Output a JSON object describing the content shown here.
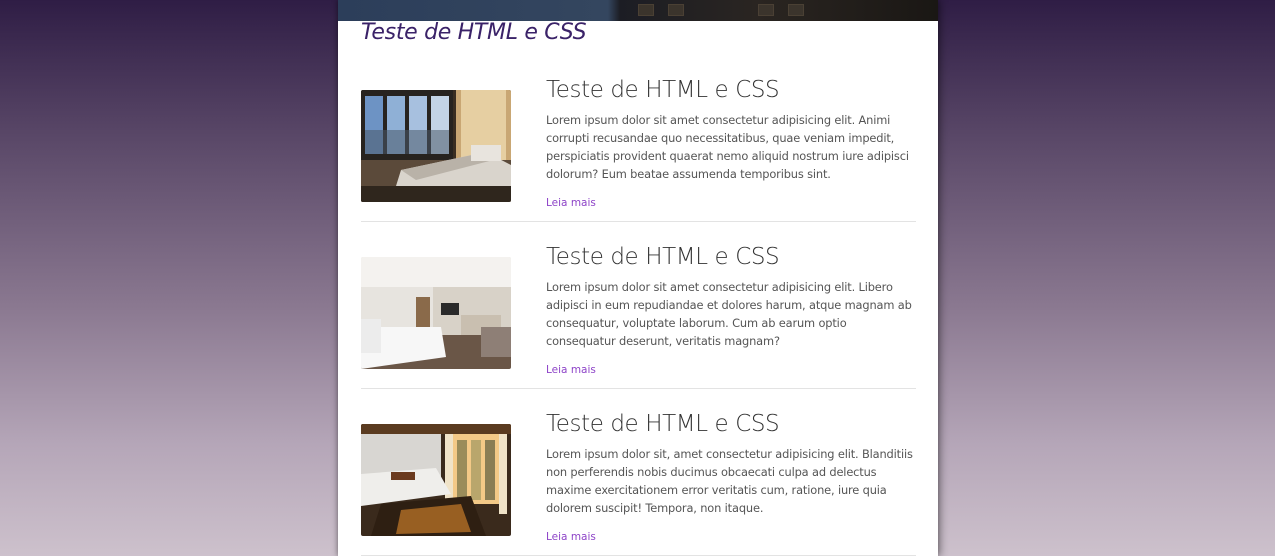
{
  "section": {
    "title": "Teste de HTML e CSS"
  },
  "posts": [
    {
      "title": "Teste de HTML e CSS",
      "text": "Lorem ipsum dolor sit amet consectetur adipisicing elit. Animi corrupti recusandae quo necessitatibus, quae veniam impedit, perspiciatis provident quaerat nemo aliquid nostrum iure adipisci dolorum? Eum beatae assumenda temporibus sint.",
      "link": "Leia mais"
    },
    {
      "title": "Teste de HTML e CSS",
      "text": "Lorem ipsum dolor sit amet consectetur adipisicing elit. Libero adipisci in eum repudiandae et dolores harum, atque magnam ab consequatur, voluptate laborum. Cum ab earum optio consequatur deserunt, veritatis magnam?",
      "link": "Leia mais"
    },
    {
      "title": "Teste de HTML e CSS",
      "text": "Lorem ipsum dolor sit, amet consectetur adipisicing elit. Blanditiis non perferendis nobis ducimus obcaecati culpa ad delectus maxime exercitationem error veritatis cum, ratione, iure quia dolorem suscipit! Tempora, non itaque.",
      "link": "Leia mais"
    }
  ],
  "colors": {
    "accent": "#8e44c8",
    "section_title": "#3a2268",
    "heading": "#333333",
    "body_text": "#555555"
  }
}
